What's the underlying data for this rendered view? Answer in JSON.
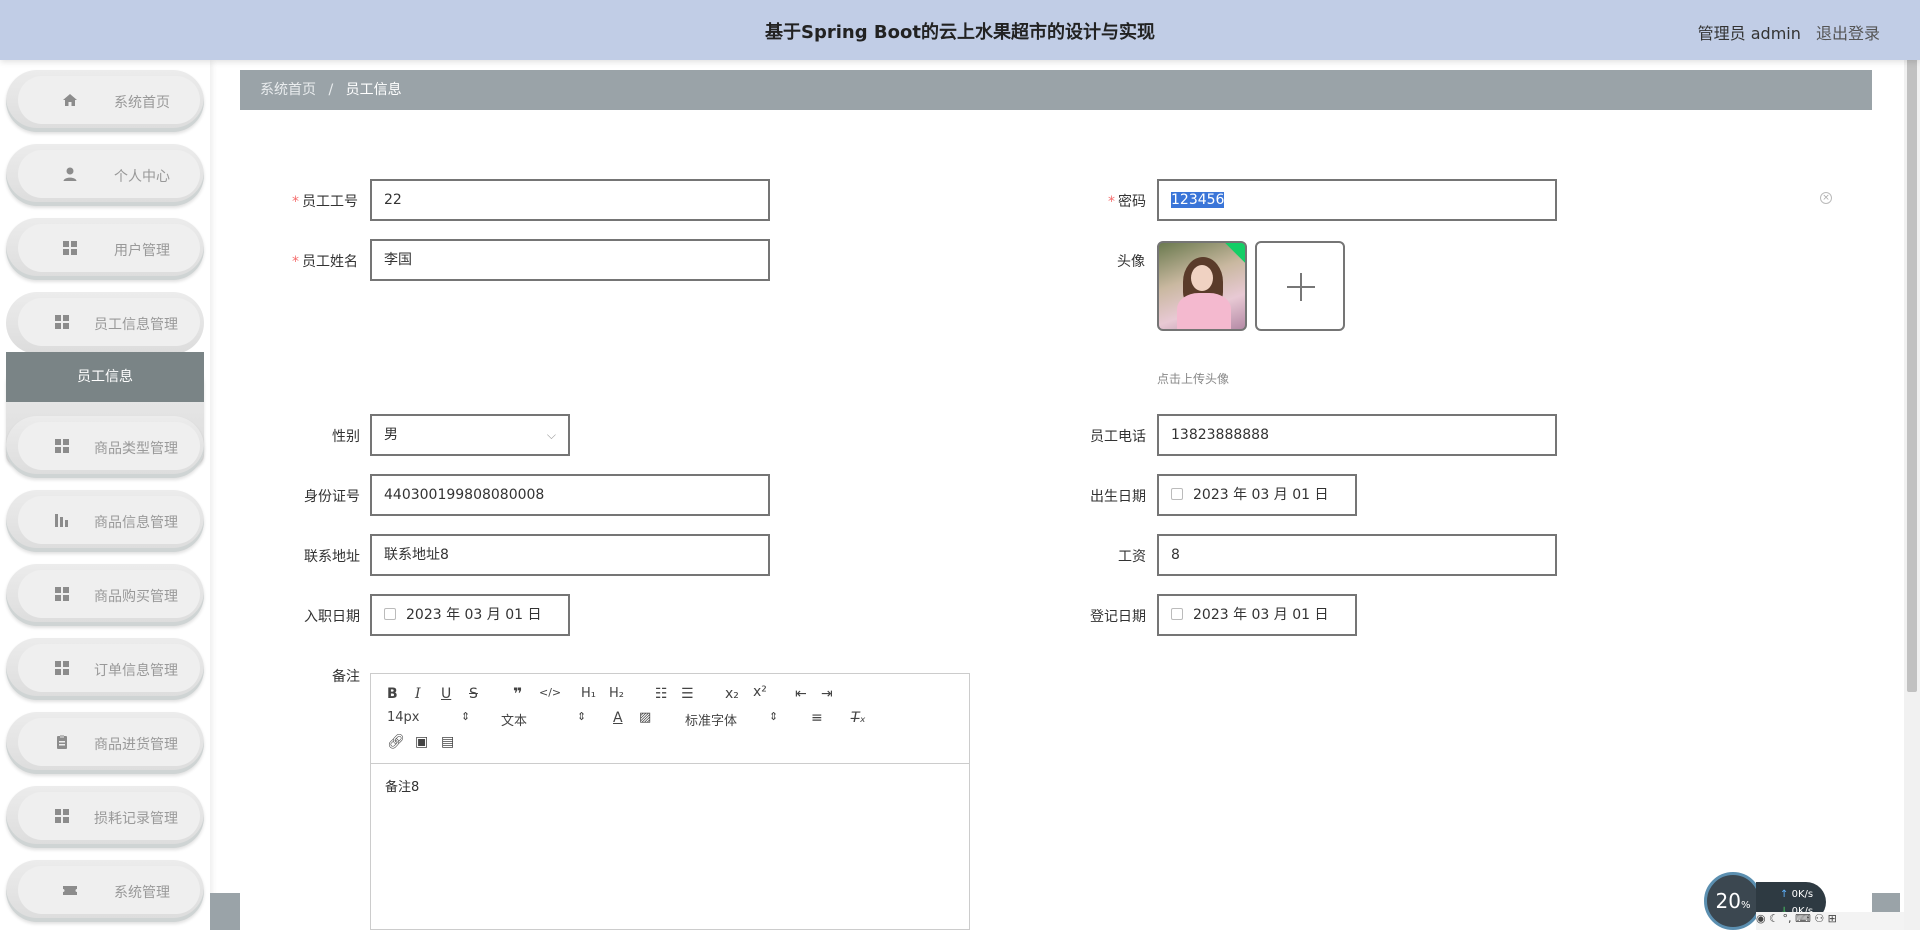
{
  "header": {
    "title": "基于Spring Boot的云上水果超市的设计与实现",
    "user_label": "管理员 admin",
    "logout_label": "退出登录"
  },
  "sidebar": {
    "items": [
      {
        "label": "系统首页",
        "icon": "home-icon"
      },
      {
        "label": "个人中心",
        "icon": "person-icon"
      },
      {
        "label": "用户管理",
        "icon": "grid-icon"
      },
      {
        "label": "员工信息管理",
        "icon": "grid-icon"
      },
      {
        "label": "商品类型管理",
        "icon": "grid-icon"
      },
      {
        "label": "商品信息管理",
        "icon": "chart-icon"
      },
      {
        "label": "商品购买管理",
        "icon": "grid-icon"
      },
      {
        "label": "订单信息管理",
        "icon": "grid-icon"
      },
      {
        "label": "商品进货管理",
        "icon": "clipboard-icon"
      },
      {
        "label": "损耗记录管理",
        "icon": "grid-icon"
      },
      {
        "label": "系统管理",
        "icon": "ticket-icon"
      }
    ],
    "active_sub_item": "员工信息"
  },
  "breadcrumb": {
    "home": "系统首页",
    "separator": "/",
    "current": "员工信息"
  },
  "form": {
    "employee_no": {
      "label": "员工工号",
      "value": "22",
      "required": true
    },
    "password": {
      "label": "密码",
      "value": "123456",
      "required": true
    },
    "employee_name": {
      "label": "员工姓名",
      "value": "李国",
      "required": true
    },
    "avatar": {
      "label": "头像",
      "hint": "点击上传头像"
    },
    "gender": {
      "label": "性别",
      "value": "男"
    },
    "phone": {
      "label": "员工电话",
      "value": "13823888888"
    },
    "id_card": {
      "label": "身份证号",
      "value": "440300199808080008"
    },
    "birth_date": {
      "label": "出生日期",
      "value": "2023 年 03 月 01 日"
    },
    "address": {
      "label": "联系地址",
      "value": "联系地址8"
    },
    "salary": {
      "label": "工资",
      "value": "8"
    },
    "hire_date": {
      "label": "入职日期",
      "value": "2023 年 03 月 01 日"
    },
    "register_date": {
      "label": "登记日期",
      "value": "2023 年 03 月 01 日"
    },
    "remark": {
      "label": "备注",
      "value": "备注8"
    }
  },
  "editor": {
    "font_size": "14px",
    "text_style": "文本",
    "font_family": "标准字体"
  },
  "speed_widget": {
    "percent": "20",
    "percent_unit": "%",
    "upload": "0",
    "download": "0",
    "unit": "K/s"
  }
}
